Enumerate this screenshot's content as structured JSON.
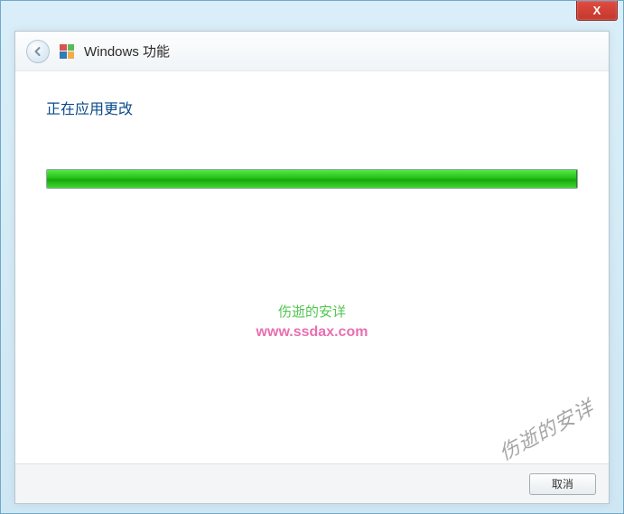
{
  "window": {
    "close_label": "X"
  },
  "header": {
    "title": "Windows 功能"
  },
  "content": {
    "status_text": "正在应用更改",
    "progress_percent": 100
  },
  "watermark": {
    "line1": "伤逝的安详",
    "line2": "www.ssdax.com",
    "corner": "伤逝的安详"
  },
  "footer": {
    "cancel_label": "取消"
  }
}
